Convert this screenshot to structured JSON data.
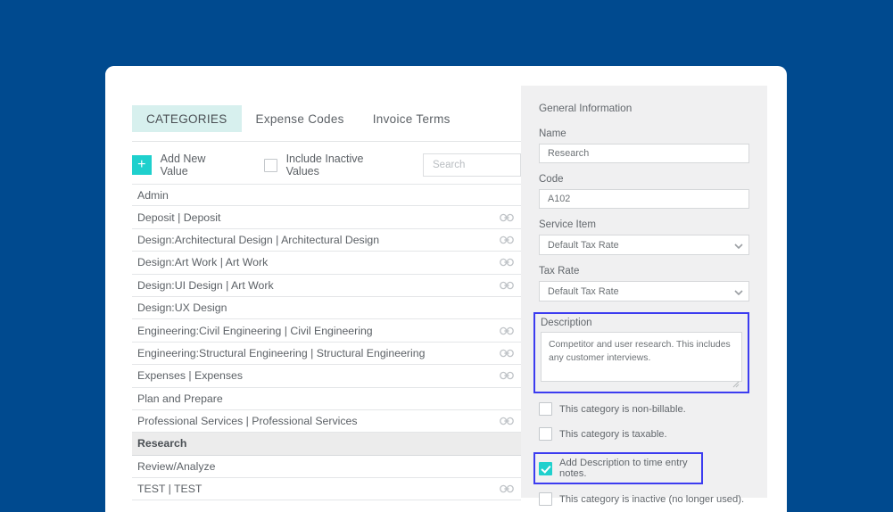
{
  "theme": {
    "background": "#004a8f",
    "card_bg": "#ffffff",
    "panel_bg": "#f0f0f1",
    "accent_teal": "#1fd0cd",
    "tab_active_bg": "#d7f0ee",
    "focus_outline": "#3c3cf0",
    "selected_row_bg": "#ececec",
    "text": "#5c6166"
  },
  "tabs": [
    {
      "label": "CATEGORIES",
      "active": true
    },
    {
      "label": "Expense Codes",
      "active": false
    },
    {
      "label": "Invoice Terms",
      "active": false
    }
  ],
  "toolbar": {
    "add_new_value_label": "Add New Value",
    "add_icon": "plus-icon",
    "include_inactive_label": "Include Inactive Values",
    "include_inactive_checked": false,
    "search_placeholder": "Search",
    "search_value": ""
  },
  "categories": [
    {
      "label": "Admin",
      "linked": false,
      "selected": false
    },
    {
      "label": "Deposit | Deposit",
      "linked": true,
      "selected": false
    },
    {
      "label": "Design:Architectural Design | Architectural Design",
      "linked": true,
      "selected": false
    },
    {
      "label": "Design:Art Work | Art Work",
      "linked": true,
      "selected": false
    },
    {
      "label": "Design:UI Design | Art Work",
      "linked": true,
      "selected": false
    },
    {
      "label": "Design:UX Design",
      "linked": false,
      "selected": false
    },
    {
      "label": "Engineering:Civil Engineering | Civil Engineering",
      "linked": true,
      "selected": false
    },
    {
      "label": "Engineering:Structural Engineering | Structural Engineering",
      "linked": true,
      "selected": false
    },
    {
      "label": "Expenses | Expenses",
      "linked": true,
      "selected": false
    },
    {
      "label": "Plan and Prepare",
      "linked": false,
      "selected": false
    },
    {
      "label": "Professional Services | Professional Services",
      "linked": true,
      "selected": false
    },
    {
      "label": "Research",
      "linked": false,
      "selected": true
    },
    {
      "label": "Review/Analyze",
      "linked": false,
      "selected": false
    },
    {
      "label": "TEST | TEST",
      "linked": true,
      "selected": false
    }
  ],
  "detail": {
    "title": "General Information",
    "name": {
      "label": "Name",
      "value": "Research"
    },
    "code": {
      "label": "Code",
      "value": "A102"
    },
    "service_item": {
      "label": "Service Item",
      "value": "Default Tax Rate",
      "icon": "chevron-down-icon"
    },
    "tax_rate": {
      "label": "Tax Rate",
      "value": "Default Tax Rate",
      "icon": "chevron-down-icon"
    },
    "description": {
      "label": "Description",
      "value": "Competitor and user research. This includes any customer interviews.",
      "focused": true
    },
    "checkboxes": [
      {
        "label": "This category is non-billable.",
        "checked": false,
        "highlighted": false
      },
      {
        "label": "This category is taxable.",
        "checked": false,
        "highlighted": false
      },
      {
        "label": "Add Description to time entry notes.",
        "checked": true,
        "highlighted": true
      },
      {
        "label": "This category is inactive (no longer used).",
        "checked": false,
        "highlighted": false
      }
    ]
  }
}
